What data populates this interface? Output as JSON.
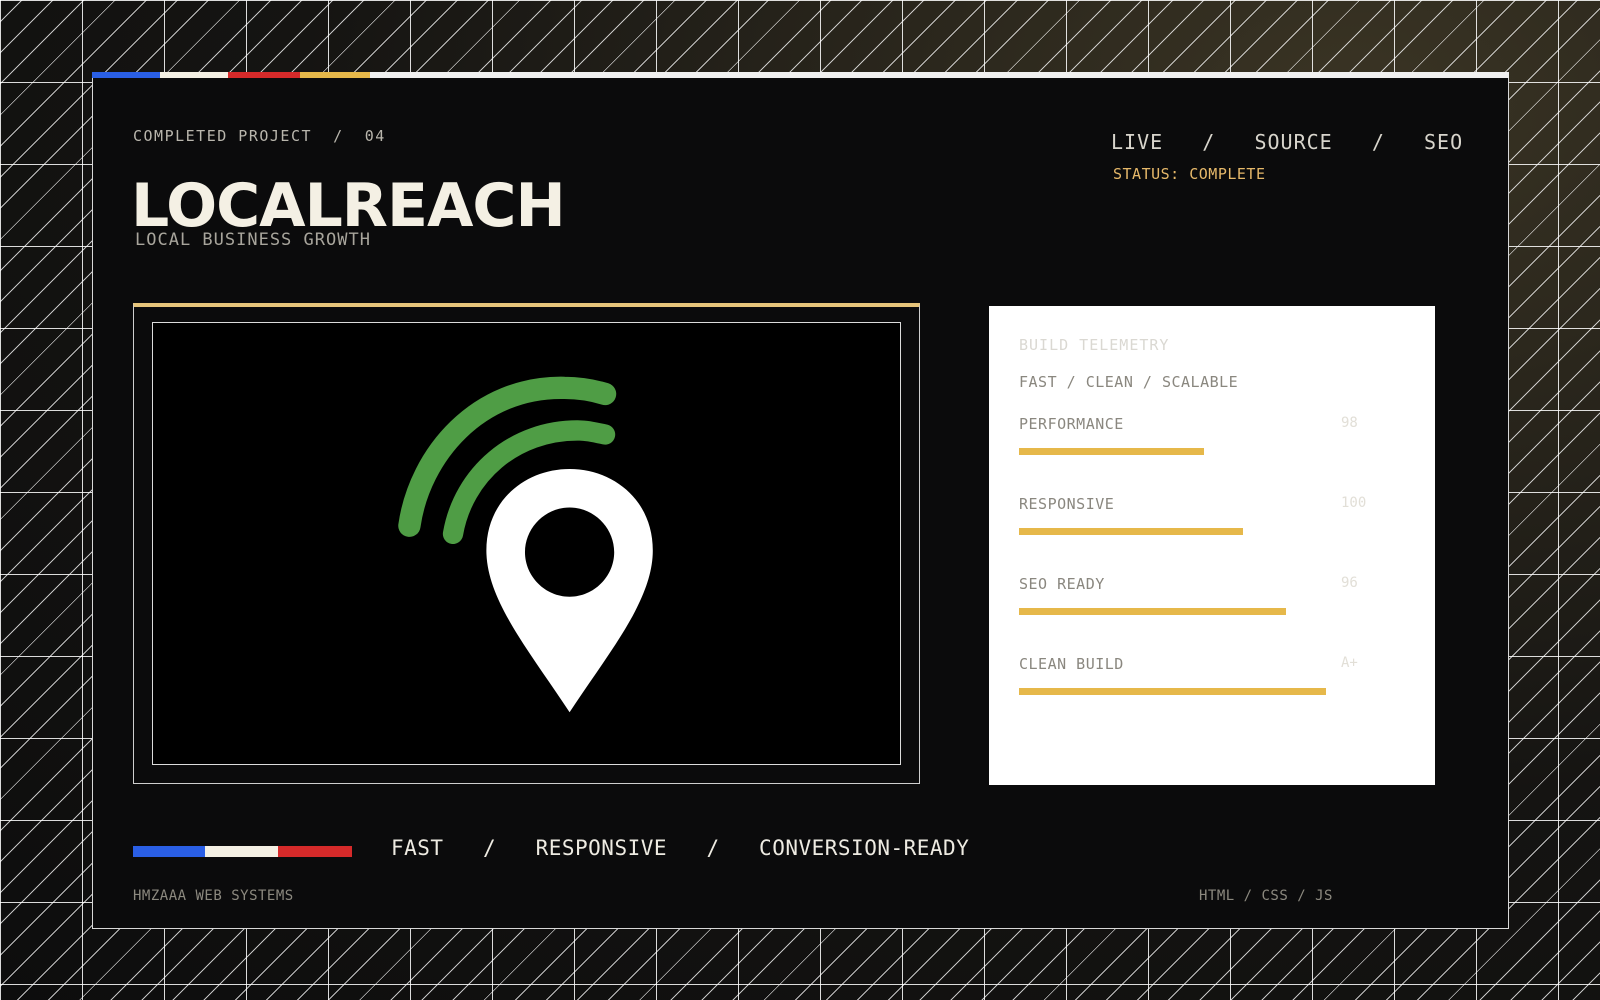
{
  "header": {
    "eyebrow_left": "COMPLETED PROJECT",
    "eyebrow_sep": "  /  ",
    "eyebrow_number": "04",
    "title": "LOCALREACH",
    "subtitle": "LOCAL BUSINESS GROWTH"
  },
  "links": {
    "live": "LIVE",
    "sep": "   /   ",
    "source": "SOURCE",
    "seo": "SEO"
  },
  "status": {
    "text": "STATUS: COMPLETE",
    "color": "#e7b96a"
  },
  "preview": {
    "icon": "location-pin-signal-icon",
    "pin_color": "#ffffff",
    "signal_color": "#4f9d45",
    "accent_color": "#e6c47a"
  },
  "telemetry": {
    "eyebrow": "BUILD TELEMETRY",
    "subtitle": "FAST / CLEAN / SCALABLE",
    "bar_color": "#e6b84a",
    "metrics": [
      {
        "label": "PERFORMANCE",
        "value": "98",
        "level": 0.56
      },
      {
        "label": "RESPONSIVE",
        "value": "100",
        "level": 0.68
      },
      {
        "label": "SEO READY",
        "value": "96",
        "level": 0.81
      },
      {
        "label": "CLEAN BUILD",
        "value": "A+",
        "level": 0.93
      }
    ]
  },
  "tagline": {
    "a": "FAST",
    "sep": "   /   ",
    "b": "RESPONSIVE",
    "c": "CONVERSION-READY"
  },
  "stripe_colors": [
    "#2a5fe6",
    "#f4f0e4",
    "#d62a2a",
    "#e6b84a"
  ],
  "footer": {
    "left": "HMZAAA WEB SYSTEMS",
    "right": "HTML / CSS / JS"
  }
}
